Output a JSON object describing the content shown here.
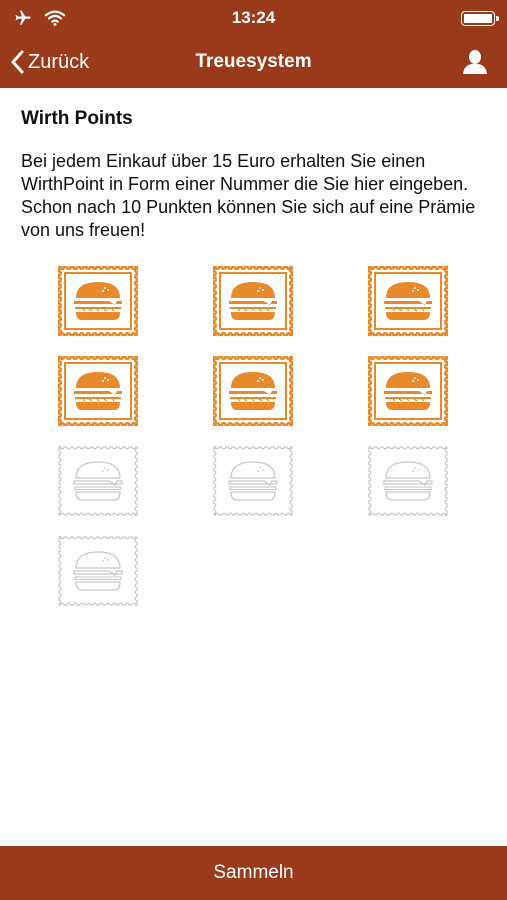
{
  "status_bar": {
    "time": "13:24",
    "left_icons": [
      "airplane-icon",
      "wifi-icon"
    ],
    "right_icon": "battery-icon"
  },
  "nav": {
    "back_label": "Zurück",
    "title": "Treuesystem",
    "right_icon": "user-icon"
  },
  "content": {
    "heading": "Wirth Points",
    "description": "Bei jedem Einkauf über 15 Euro erhalten Sie einen WirthPoint in Form einer Nummer die Sie hier eingeben. Schon nach 10 Punkten können Sie sich auf eine Prämie von uns freuen!"
  },
  "stamps": {
    "total": 10,
    "collected": 6,
    "icon": "burger-stamp-icon"
  },
  "footer": {
    "collect_label": "Sammeln"
  },
  "colors": {
    "bar": "#9a3a1a",
    "stamp_active": "#e8892a",
    "stamp_inactive": "#c8c8c8"
  }
}
